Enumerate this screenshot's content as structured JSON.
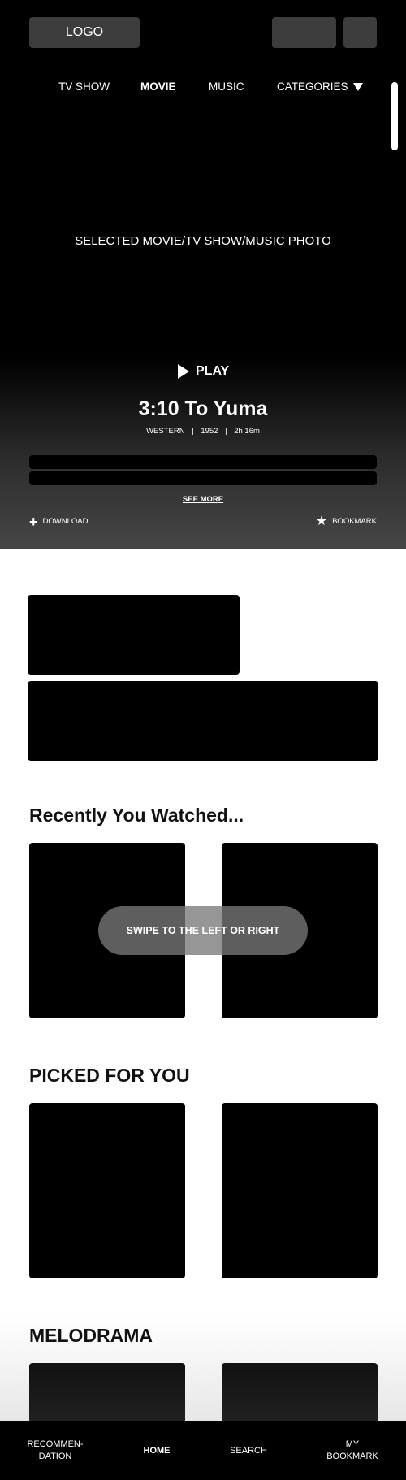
{
  "header": {
    "logo_label": "LOGO"
  },
  "top_nav": {
    "items": [
      {
        "label": "TV SHOW",
        "active": false
      },
      {
        "label": "MOVIE",
        "active": true
      },
      {
        "label": "MUSIC",
        "active": false
      },
      {
        "label": "CATEGORIES",
        "active": false
      }
    ],
    "categories_icon": "caret-down-icon"
  },
  "hero": {
    "photo_placeholder": "SELECTED MOVIE/TV SHOW/MUSIC PHOTO",
    "play_label": "PLAY",
    "play_icon": "play-icon",
    "title": "3:10 To Yuma",
    "genre": "WESTERN",
    "year": "1952",
    "duration": "2h 16m",
    "separator": "|",
    "see_more_label": "SEE MORE",
    "download_label": "DOWNLOAD",
    "download_icon": "plus-icon",
    "bookmark_label": "BOOKMARK",
    "bookmark_icon": "star-icon"
  },
  "sections": {
    "recent_title": "Recently You Watched...",
    "picked_title": "PICKED FOR YOU",
    "melodrama_title": "MELODRAMA"
  },
  "swipe_hint": "SWIPE TO THE LEFT OR RIGHT",
  "bottom_nav": {
    "recommendation_line1": "RECOMMEN-",
    "recommendation_line2": "DATION",
    "home": "HOME",
    "search": "SEARCH",
    "bookmark_line1": "MY",
    "bookmark_line2": "BOOKMARK",
    "active": "HOME"
  },
  "colors": {
    "background": "#ffffff",
    "hero_top": "#000000",
    "hero_bottom": "#464646",
    "button_fill": "#3c3c3c",
    "swipe_pill": "#787878",
    "text_light": "#ffffff",
    "text_dark": "#111111"
  }
}
